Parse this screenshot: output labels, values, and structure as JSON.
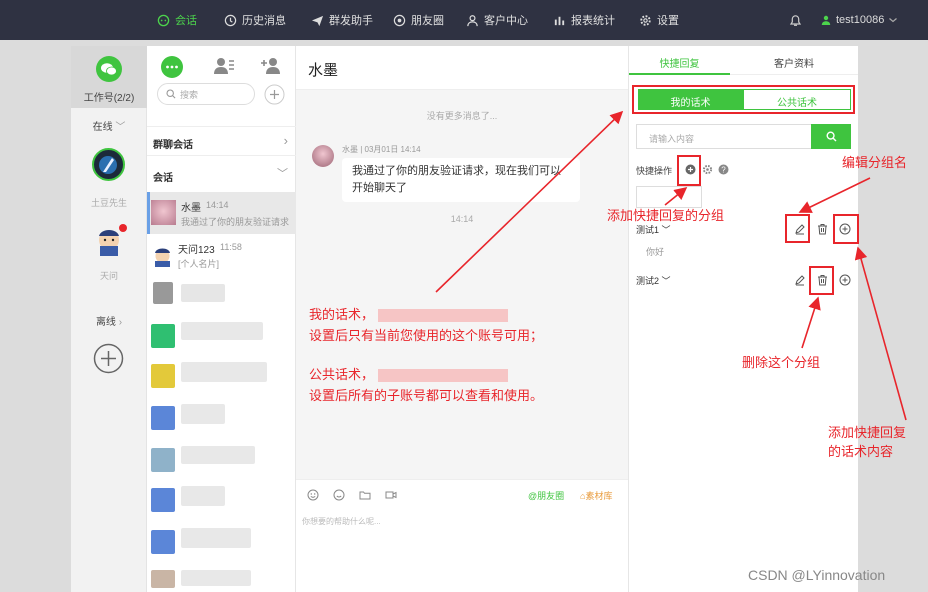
{
  "nav": {
    "items": [
      {
        "label": "会话",
        "icon": "chat-icon"
      },
      {
        "label": "历史消息",
        "icon": "clock-icon"
      },
      {
        "label": "群发助手",
        "icon": "send-icon"
      },
      {
        "label": "朋友圈",
        "icon": "aperture-icon"
      },
      {
        "label": "客户中心",
        "icon": "person-icon"
      },
      {
        "label": "报表统计",
        "icon": "bar-chart-icon"
      },
      {
        "label": "设置",
        "icon": "gear-icon"
      }
    ],
    "user": "test10086",
    "accent": "#4cd44c"
  },
  "accounts": {
    "label": "工作号(2/2)",
    "online_label": "在线",
    "offline_label": "离线",
    "users": [
      {
        "name": "土豆先生"
      },
      {
        "name": "天问"
      }
    ]
  },
  "contacts": {
    "search_placeholder": "搜索",
    "group_chat_label": "群聊会话",
    "session_label": "会话",
    "items": [
      {
        "name": "水墨",
        "time": "14:14",
        "preview": "我通过了你的朋友验证请求"
      },
      {
        "name": "天问123",
        "time": "11:58",
        "preview": "[个人名片]"
      }
    ]
  },
  "chat": {
    "title": "水墨",
    "no_more": "没有更多消息了...",
    "message": {
      "sender": "水墨",
      "date": "03月01日 14:14",
      "text": "我通过了你的朋友验证请求，现在我们可以开始聊天了"
    },
    "time_divider": "14:14",
    "toolbar": {
      "moments": "@朋友圈",
      "materials": "素材库"
    },
    "input_placeholder": "你想要的帮助什么呢..."
  },
  "panel": {
    "tabs": [
      "快捷回复",
      "客户资料"
    ],
    "my_phrases": "我的话术",
    "public_phrases": "公共话术",
    "search_placeholder": "请输入内容",
    "quick_ops": "快捷操作",
    "groups": [
      {
        "name": "测试1",
        "items": [
          "你好"
        ]
      },
      {
        "name": "测试2",
        "items": []
      }
    ]
  },
  "annotations": {
    "add_group": "添加快捷回复的分组",
    "edit_group": "编辑分组名",
    "delete_group": "删除这个分组",
    "add_phrase_1": "添加快捷回复",
    "add_phrase_2": "的话术内容",
    "my_title": "我的话术，",
    "my_desc": "设置后只有当前您使用的这个账号可用；",
    "public_title": "公共话术，",
    "public_desc": "设置后所有的子账号都可以查看和使用。",
    "color": "#e8252b"
  },
  "watermark": "CSDN @LYinnovation"
}
